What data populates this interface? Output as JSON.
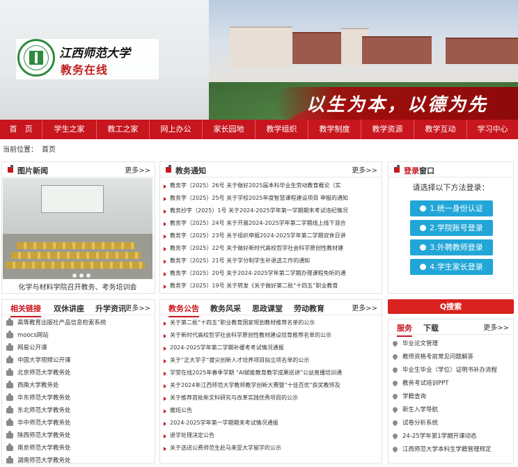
{
  "header": {
    "university_name": "江西师范大学",
    "site_name": "教务在线",
    "slogan": "以生为本，以德为先"
  },
  "nav": {
    "items": [
      "首　页",
      "学生之家",
      "教工之家",
      "网上办公",
      "家长园地",
      "教学组织",
      "教学制度",
      "教学资源",
      "教学互动",
      "学习中心"
    ]
  },
  "breadcrumb": {
    "label": "当前位置：",
    "current": "首页"
  },
  "photo_news": {
    "title": "图片新闻",
    "more": "更多>>",
    "caption": "化学与材料学院召开教务、考务培训会"
  },
  "notices": {
    "title": "教务通知",
    "more": "更多>>",
    "items": [
      "教务字（2025）26号 关于做好2025届本科毕业生劳动教育概论（实",
      "教务字（2025）25号 关于学校2025年度智慧课程建设项目 申报的通知",
      "教务抄字（2025）1号 关于2024-2025学年第一学期期末考试违纪情况",
      "教务字（2025）24号 关于开展2024-2025学年第二学期线上线下混合",
      "教务字（2025）23号 关于组织申报2024-2025学年第二学期双休日讲",
      "教务字（2025）22号 关于做好新时代高校哲学社会科学原创性教材建",
      "教务字（2025）21号 关于学分制学生补退选工作的通知",
      "教务字（2025）20号 关于2024-2025学年第二学期办理课程免听的通",
      "教务字（2025）19号 关于转发《关于做好第二批“十四五”职业教育"
    ]
  },
  "login": {
    "title_highlight": "登录",
    "title_rest": "窗口",
    "prompt": "请选择以下方法登录：",
    "buttons": [
      "1.统一身份认证",
      "2.学院账号登录",
      "3.外聘教师登录",
      "4.学生家长登录"
    ]
  },
  "links": {
    "tabs": [
      "相关链接",
      "双休讲座",
      "升学资讯"
    ],
    "more": "更多>>",
    "items": [
      "高等教育出版社产品信息检索系统",
      "moocs网站",
      "网易公开课",
      "中国大学视频公开课",
      "北京师范大学教务处",
      "西南大学教务处",
      "华东师范大学教务处",
      "东北师范大学教务处",
      "华中师范大学教务处",
      "陕西师范大学教务处",
      "南京师范大学教务处",
      "湖南师范大学教务处"
    ]
  },
  "announcements": {
    "tabs": [
      "教务公告",
      "教务风采",
      "思政课堂",
      "劳动教育"
    ],
    "more": "更多>>",
    "items": [
      "关于第二批“十四五”职业教育国家规划教材推荐名单的公示",
      "关于新时代高校哲学社会科学原创性教材建设培育推荐名单的公示",
      "2024-2025学年第二学期补缓考考试情况通报",
      "关于“正大学子”拔尖创新人才培养项目拟立项名单的公示",
      "学堂在线2025年春季学期 “AI赋能教育教学成果巡讲”公益直播培训通",
      "关于2024年江西师范大学教师教学创新大赛暨“十佳百优”获奖教师及",
      "关于推荐首批新文科研究与改革实践优秀项目的公示",
      "撤班公告",
      "2024-2025学年第一学期期末考试情况通报",
      "退学处理决定公告",
      "关于选送公费师范生赴马来亚大学留学的公示"
    ]
  },
  "search": {
    "label": "Q搜索"
  },
  "services": {
    "tabs": [
      "服务",
      "下载"
    ],
    "more": "更多>>",
    "items": [
      "毕业论文管理",
      "教师资格考前常见问题解答",
      "毕业生毕业（学位）证明书补办流程",
      "教务考试培训PPT",
      "学籍查询",
      "新生入学导航",
      "试卷分析系统",
      "24-25学年第1学期开课动态",
      "江西师范大学本科生学籍管理规定"
    ]
  }
}
